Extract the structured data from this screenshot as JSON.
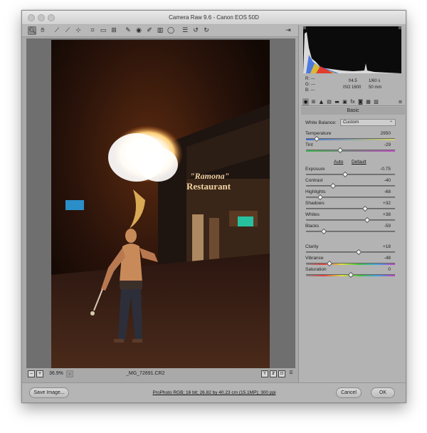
{
  "window": {
    "title": "Camera Raw 9.6 - Canon EOS 50D"
  },
  "toolbar": {
    "tools": [
      "zoom-icon",
      "hand-icon",
      "white-balance-icon",
      "color-sampler-icon",
      "target-adjust-icon",
      "crop-icon",
      "straighten-icon",
      "spot-removal-icon",
      "red-eye-icon",
      "adjustment-brush-icon",
      "graduated-filter-icon",
      "radial-filter-icon",
      "presets-icon",
      "rotate-ccw-icon",
      "rotate-cw-icon"
    ],
    "open_prefs_icon": "export-icon"
  },
  "statusbar": {
    "zoom": "36.9%",
    "zoom_caret": "⌄",
    "filename": "_MG_72691.CR2"
  },
  "readout": {
    "r_label": "R:",
    "r_value": "---",
    "g_label": "G:",
    "g_value": "---",
    "b_label": "B:",
    "b_value": "---",
    "aperture": "f/4.5",
    "shutter": "1/60 s",
    "iso": "ISO 1600",
    "focal": "50 mm"
  },
  "panel": {
    "title": "Basic",
    "white_balance_label": "White Balance:",
    "white_balance_value": "Custom",
    "auto": "Auto",
    "default": "Default",
    "sliders": [
      {
        "name": "Temperature",
        "value": "2950",
        "pos": 0.12
      },
      {
        "name": "Tint",
        "value": "-29",
        "pos": 0.38
      },
      {
        "name": "Exposure",
        "value": "-0.75",
        "pos": 0.44
      },
      {
        "name": "Contrast",
        "value": "-40",
        "pos": 0.3
      },
      {
        "name": "Highlights",
        "value": "-68",
        "pos": 0.16
      },
      {
        "name": "Shadows",
        "value": "+32",
        "pos": 0.66
      },
      {
        "name": "Whites",
        "value": "+38",
        "pos": 0.69
      },
      {
        "name": "Blacks",
        "value": "-59",
        "pos": 0.2
      },
      {
        "name": "Clarity",
        "value": "+18",
        "pos": 0.59
      },
      {
        "name": "Vibrance",
        "value": "-48",
        "pos": 0.26
      },
      {
        "name": "Saturation",
        "value": "0",
        "pos": 0.5
      }
    ]
  },
  "footer": {
    "save": "Save Image...",
    "workflow": "ProPhoto RGB; 16 bit; 26.82 by 40.23 cm (15.1MP); 300 ppi",
    "cancel": "Cancel",
    "ok": "OK"
  },
  "photo": {
    "sign1": "\"Ramona\"",
    "sign2": "Restaurant"
  },
  "colors": {
    "window_bg": "#a9a9a9",
    "panel_bg": "#b3b3b3",
    "preview_bg": "#6f6f6f"
  }
}
